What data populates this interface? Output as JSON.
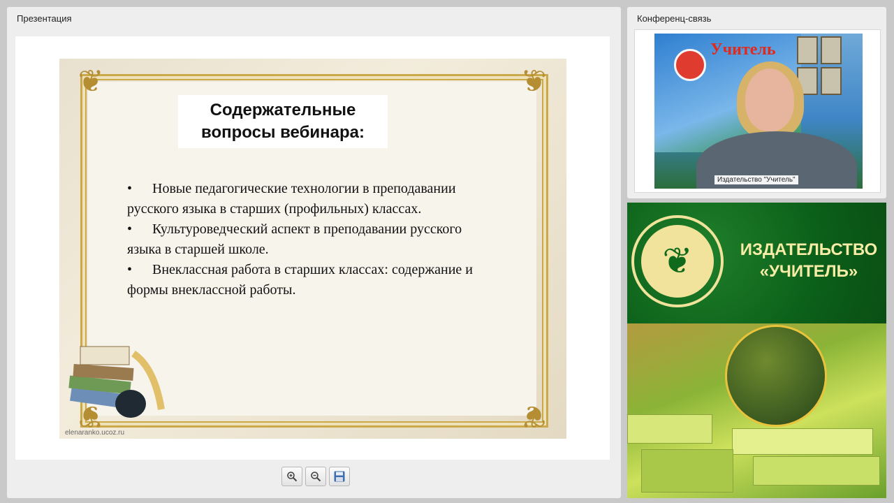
{
  "presentation_panel": {
    "title": "Презентация"
  },
  "slide": {
    "title": "Содержательные вопросы вебинара:",
    "bullets": [
      "Новые педагогические технологии в преподавании русского языка в старших (профильных) классах.",
      "Культуроведческий аспект в преподавании русского языка в старшей школе.",
      "Внеклассная работа в старших классах: содержание и формы внеклассной работы."
    ],
    "bullet_symbol": "•",
    "watermark": "elenaranko.ucoz.ru"
  },
  "toolbar": {
    "zoom_in_icon": "zoom-in-icon",
    "zoom_out_icon": "zoom-out-icon",
    "save_icon": "save-icon"
  },
  "conference_panel": {
    "title": "Конференц-связь",
    "video_caption": "Издательство \"Учитель\"",
    "video_banner_text": "Учитель"
  },
  "promo": {
    "publisher_name_line1": "ИЗДАТЕЛЬСТВО",
    "publisher_name_line2": "«УЧИТЕЛЬ»"
  },
  "colors": {
    "frame_gold": "#c9a94a",
    "promo_green": "#0b5f19",
    "promo_text": "#f6eca6"
  }
}
